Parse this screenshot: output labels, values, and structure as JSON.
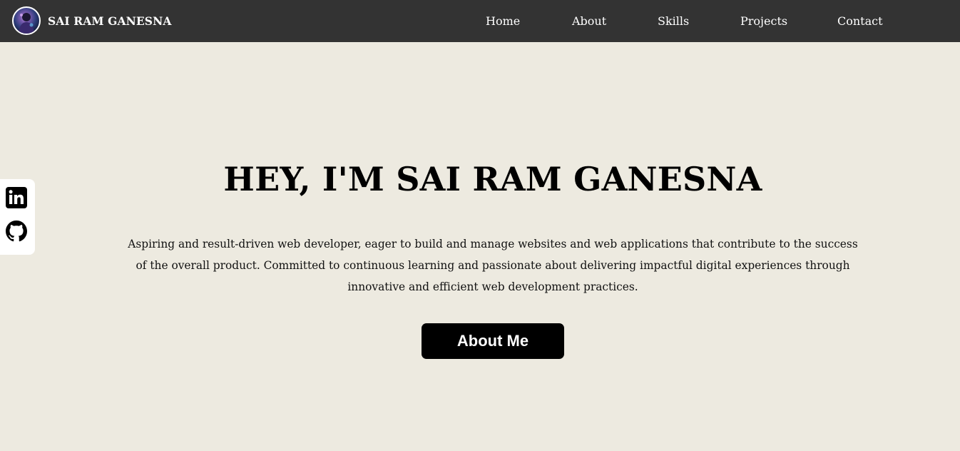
{
  "navbar": {
    "brand_name": "SAI RAM GANESNA",
    "links": [
      {
        "label": "Home"
      },
      {
        "label": "About"
      },
      {
        "label": "Skills"
      },
      {
        "label": "Projects"
      },
      {
        "label": "Contact"
      }
    ]
  },
  "social": {
    "icons": [
      "linkedin-icon",
      "github-icon"
    ]
  },
  "hero": {
    "title": "HEY, I'M SAI RAM GANESNA",
    "description": "Aspiring and result-driven web developer, eager to build and manage websites and web applications that contribute to the success of the overall product. Committed to continuous learning and passionate about delivering impactful digital experiences through innovative and efficient web development practices.",
    "button_label": "About Me"
  },
  "colors": {
    "navbar_bg": "#333333",
    "page_bg": "#edeae0",
    "button_bg": "#000000",
    "text_dark": "#000000",
    "text_light": "#ffffff"
  }
}
